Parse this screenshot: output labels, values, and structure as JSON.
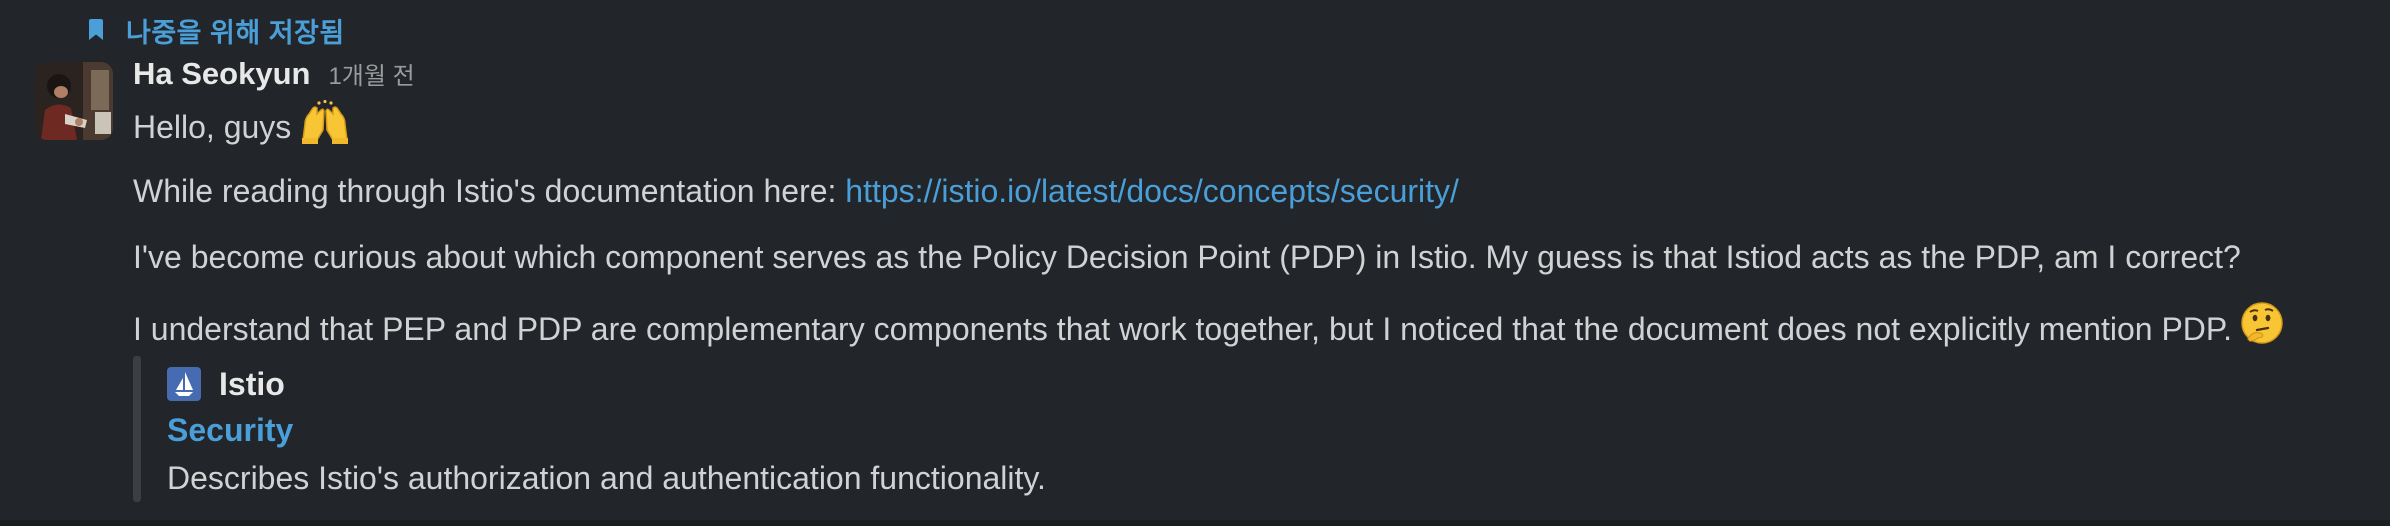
{
  "saved": {
    "label": "나중을 위해 저장됨",
    "icon": "bookmark-icon",
    "color": "#4a9fd8"
  },
  "message": {
    "sender": "Ha Seokyun",
    "timestamp": "1개월 전",
    "avatar": "avatar",
    "lines": {
      "greeting": "Hello, guys",
      "greeting_emoji": "raising-hands-icon",
      "reading_prefix": "While reading through Istio's documentation here: ",
      "reading_link": "https://istio.io/latest/docs/concepts/security/",
      "question": "I've become curious about which component serves as the Policy Decision Point (PDP) in Istio. My guess is that Istiod acts as the PDP, am I correct?",
      "understand": "I understand that PEP and PDP are complementary components that work together, but I noticed that the document does not explicitly mention PDP.",
      "understand_emoji": "thinking-face-icon"
    }
  },
  "unfurl": {
    "site_icon": "istio-logo-icon",
    "site_name": "Istio",
    "title": "Security",
    "description": "Describes Istio's authorization and authentication functionality."
  },
  "colors": {
    "background": "#222529",
    "link": "#4a9fd8",
    "text": "#d1d2d3",
    "muted": "#9a9b9d",
    "istio_icon": "#466bb0"
  }
}
